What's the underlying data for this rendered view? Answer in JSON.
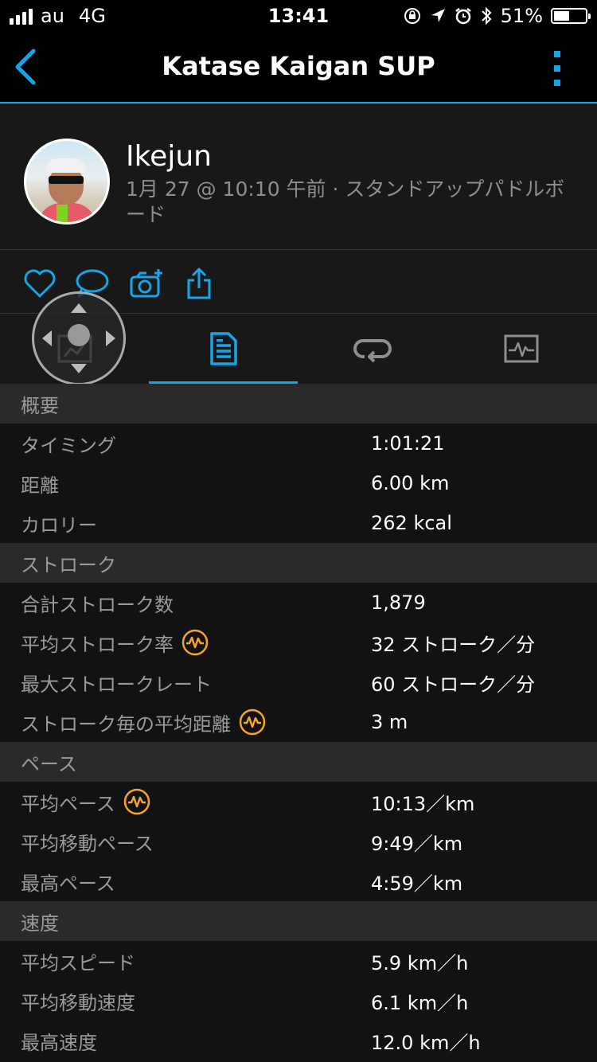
{
  "status_bar": {
    "carrier": "au",
    "network": "4G",
    "time": "13:41",
    "battery_percent_text": "51%",
    "battery_level": 0.51
  },
  "nav": {
    "title": "Katase Kaigan SUP",
    "back_icon": "chevron-left-icon",
    "menu_icon": "more-vertical-icon",
    "accent_color": "#16a5e9"
  },
  "profile": {
    "username": "Ikejun",
    "meta": "1月 27 @ 10:10 午前 · スタンドアップパドルボード"
  },
  "actions": [
    {
      "icon": "heart-icon"
    },
    {
      "icon": "comment-icon"
    },
    {
      "icon": "add-photo-icon"
    },
    {
      "icon": "share-icon"
    }
  ],
  "tabs": [
    {
      "icon": "map-icon",
      "active": false
    },
    {
      "icon": "summary-list-icon",
      "active": true
    },
    {
      "icon": "laps-icon",
      "active": false
    },
    {
      "icon": "chart-icon",
      "active": false
    }
  ],
  "sections": {
    "overview": {
      "title": "概要",
      "rows": [
        {
          "label": "タイミング",
          "value": "1:01:21"
        },
        {
          "label": "距離",
          "value": "6.00 km"
        },
        {
          "label": "カロリー",
          "value": "262 kcal"
        }
      ]
    },
    "stroke": {
      "title": "ストローク",
      "rows": [
        {
          "label": "合計ストローク数",
          "value": "1,879"
        },
        {
          "label": "平均ストローク率",
          "value": "32 ストローク／分"
        },
        {
          "label": "最大ストロークレート",
          "value": "60 ストローク／分"
        },
        {
          "label": "ストローク毎の平均距離",
          "value": "3 m"
        }
      ]
    },
    "pace": {
      "title": "ペース",
      "rows": [
        {
          "label": "平均ペース",
          "value": "10:13／km"
        },
        {
          "label": "平均移動ペース",
          "value": "9:49／km"
        },
        {
          "label": "最高ペース",
          "value": "4:59／km"
        }
      ]
    },
    "speed": {
      "title": "速度",
      "rows": [
        {
          "label": "平均スピード",
          "value": "5.9 km／h"
        },
        {
          "label": "平均移動速度",
          "value": "6.1 km／h"
        },
        {
          "label": "最高速度",
          "value": "12.0 km／h"
        }
      ]
    }
  },
  "badge_color": "#f5a623"
}
